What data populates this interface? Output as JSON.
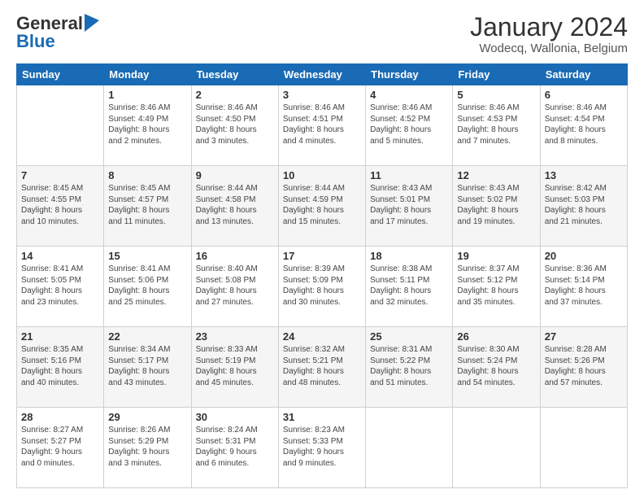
{
  "header": {
    "logo_line1": "General",
    "logo_line2": "Blue",
    "month": "January 2024",
    "location": "Wodecq, Wallonia, Belgium"
  },
  "weekdays": [
    "Sunday",
    "Monday",
    "Tuesday",
    "Wednesday",
    "Thursday",
    "Friday",
    "Saturday"
  ],
  "weeks": [
    [
      {
        "day": "",
        "info": ""
      },
      {
        "day": "1",
        "info": "Sunrise: 8:46 AM\nSunset: 4:49 PM\nDaylight: 8 hours\nand 2 minutes."
      },
      {
        "day": "2",
        "info": "Sunrise: 8:46 AM\nSunset: 4:50 PM\nDaylight: 8 hours\nand 3 minutes."
      },
      {
        "day": "3",
        "info": "Sunrise: 8:46 AM\nSunset: 4:51 PM\nDaylight: 8 hours\nand 4 minutes."
      },
      {
        "day": "4",
        "info": "Sunrise: 8:46 AM\nSunset: 4:52 PM\nDaylight: 8 hours\nand 5 minutes."
      },
      {
        "day": "5",
        "info": "Sunrise: 8:46 AM\nSunset: 4:53 PM\nDaylight: 8 hours\nand 7 minutes."
      },
      {
        "day": "6",
        "info": "Sunrise: 8:46 AM\nSunset: 4:54 PM\nDaylight: 8 hours\nand 8 minutes."
      }
    ],
    [
      {
        "day": "7",
        "info": "Sunrise: 8:45 AM\nSunset: 4:55 PM\nDaylight: 8 hours\nand 10 minutes."
      },
      {
        "day": "8",
        "info": "Sunrise: 8:45 AM\nSunset: 4:57 PM\nDaylight: 8 hours\nand 11 minutes."
      },
      {
        "day": "9",
        "info": "Sunrise: 8:44 AM\nSunset: 4:58 PM\nDaylight: 8 hours\nand 13 minutes."
      },
      {
        "day": "10",
        "info": "Sunrise: 8:44 AM\nSunset: 4:59 PM\nDaylight: 8 hours\nand 15 minutes."
      },
      {
        "day": "11",
        "info": "Sunrise: 8:43 AM\nSunset: 5:01 PM\nDaylight: 8 hours\nand 17 minutes."
      },
      {
        "day": "12",
        "info": "Sunrise: 8:43 AM\nSunset: 5:02 PM\nDaylight: 8 hours\nand 19 minutes."
      },
      {
        "day": "13",
        "info": "Sunrise: 8:42 AM\nSunset: 5:03 PM\nDaylight: 8 hours\nand 21 minutes."
      }
    ],
    [
      {
        "day": "14",
        "info": "Sunrise: 8:41 AM\nSunset: 5:05 PM\nDaylight: 8 hours\nand 23 minutes."
      },
      {
        "day": "15",
        "info": "Sunrise: 8:41 AM\nSunset: 5:06 PM\nDaylight: 8 hours\nand 25 minutes."
      },
      {
        "day": "16",
        "info": "Sunrise: 8:40 AM\nSunset: 5:08 PM\nDaylight: 8 hours\nand 27 minutes."
      },
      {
        "day": "17",
        "info": "Sunrise: 8:39 AM\nSunset: 5:09 PM\nDaylight: 8 hours\nand 30 minutes."
      },
      {
        "day": "18",
        "info": "Sunrise: 8:38 AM\nSunset: 5:11 PM\nDaylight: 8 hours\nand 32 minutes."
      },
      {
        "day": "19",
        "info": "Sunrise: 8:37 AM\nSunset: 5:12 PM\nDaylight: 8 hours\nand 35 minutes."
      },
      {
        "day": "20",
        "info": "Sunrise: 8:36 AM\nSunset: 5:14 PM\nDaylight: 8 hours\nand 37 minutes."
      }
    ],
    [
      {
        "day": "21",
        "info": "Sunrise: 8:35 AM\nSunset: 5:16 PM\nDaylight: 8 hours\nand 40 minutes."
      },
      {
        "day": "22",
        "info": "Sunrise: 8:34 AM\nSunset: 5:17 PM\nDaylight: 8 hours\nand 43 minutes."
      },
      {
        "day": "23",
        "info": "Sunrise: 8:33 AM\nSunset: 5:19 PM\nDaylight: 8 hours\nand 45 minutes."
      },
      {
        "day": "24",
        "info": "Sunrise: 8:32 AM\nSunset: 5:21 PM\nDaylight: 8 hours\nand 48 minutes."
      },
      {
        "day": "25",
        "info": "Sunrise: 8:31 AM\nSunset: 5:22 PM\nDaylight: 8 hours\nand 51 minutes."
      },
      {
        "day": "26",
        "info": "Sunrise: 8:30 AM\nSunset: 5:24 PM\nDaylight: 8 hours\nand 54 minutes."
      },
      {
        "day": "27",
        "info": "Sunrise: 8:28 AM\nSunset: 5:26 PM\nDaylight: 8 hours\nand 57 minutes."
      }
    ],
    [
      {
        "day": "28",
        "info": "Sunrise: 8:27 AM\nSunset: 5:27 PM\nDaylight: 9 hours\nand 0 minutes."
      },
      {
        "day": "29",
        "info": "Sunrise: 8:26 AM\nSunset: 5:29 PM\nDaylight: 9 hours\nand 3 minutes."
      },
      {
        "day": "30",
        "info": "Sunrise: 8:24 AM\nSunset: 5:31 PM\nDaylight: 9 hours\nand 6 minutes."
      },
      {
        "day": "31",
        "info": "Sunrise: 8:23 AM\nSunset: 5:33 PM\nDaylight: 9 hours\nand 9 minutes."
      },
      {
        "day": "",
        "info": ""
      },
      {
        "day": "",
        "info": ""
      },
      {
        "day": "",
        "info": ""
      }
    ]
  ]
}
